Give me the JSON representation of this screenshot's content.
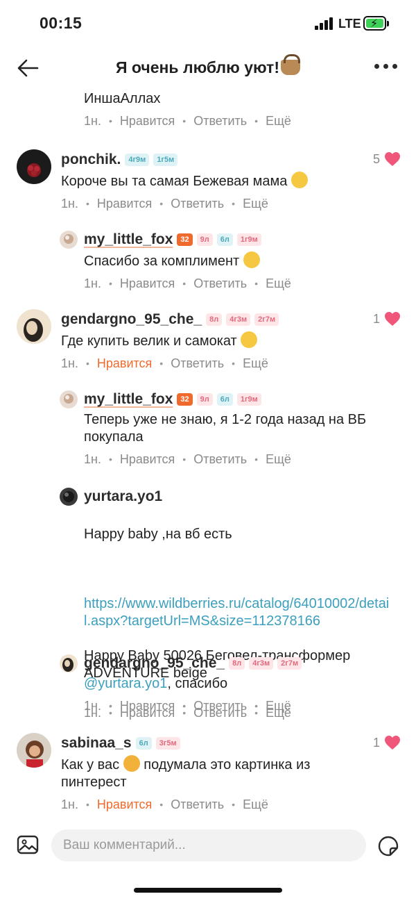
{
  "status_bar": {
    "time": "00:15",
    "network": "LTE"
  },
  "header": {
    "title": "Я очень люблю уют!",
    "title_emoji": "basket-emoji"
  },
  "actions": {
    "like": "Нравится",
    "reply": "Ответить",
    "more": "Ещё"
  },
  "colors": {
    "accent": "#ef6a2c",
    "heart": "#f0557a",
    "link": "#3b9fbd",
    "badge_teal": "#4aa9bb",
    "badge_pink": "#e26a7c"
  },
  "comments": [
    {
      "id": "c0",
      "kind": "reply",
      "text": "ИншаАллах",
      "time": "1н."
    },
    {
      "id": "c1",
      "kind": "top",
      "username": "ponchik.",
      "badges": [
        {
          "text": "4г9м",
          "style": "teal"
        },
        {
          "text": "1г5м",
          "style": "teal"
        }
      ],
      "text": "Короче вы та самая Бежевая мама",
      "time": "1н.",
      "likes": "5"
    },
    {
      "id": "c2",
      "kind": "reply",
      "username": "my_little_fox",
      "badges": [
        {
          "text": "32",
          "style": "orange"
        },
        {
          "text": "9л",
          "style": "pink"
        },
        {
          "text": "6л",
          "style": "teal"
        },
        {
          "text": "1г9м",
          "style": "pink"
        }
      ],
      "text": "Спасибо за комплимент",
      "time": "1н."
    },
    {
      "id": "c3",
      "kind": "top",
      "username": "gendargno_95_che_",
      "badges": [
        {
          "text": "8л",
          "style": "pink"
        },
        {
          "text": "4г3м",
          "style": "pink"
        },
        {
          "text": "2г7м",
          "style": "pink"
        }
      ],
      "text": "Где купить велик и самокат",
      "time": "1н.",
      "likes": "1",
      "liked": true
    },
    {
      "id": "c4",
      "kind": "reply",
      "username": "my_little_fox",
      "badges": [
        {
          "text": "32",
          "style": "orange"
        },
        {
          "text": "9л",
          "style": "pink"
        },
        {
          "text": "6л",
          "style": "teal"
        },
        {
          "text": "1г9м",
          "style": "pink"
        }
      ],
      "text": "Теперь уже не знаю, я 1-2 года назад на ВБ покупала",
      "time": "1н."
    },
    {
      "id": "c5",
      "kind": "reply",
      "username": "yurtara.yo1",
      "badges": [],
      "text_before": "Happy baby ,на вб есть",
      "link": "https://www.wildberries.ru/catalog/64010002/detail.aspx?targetUrl=MS&size=112378166",
      "text_after": "Happy Baby 50026 Беговел-трансформер ADVENTURE beige",
      "time": "1н."
    },
    {
      "id": "c6",
      "kind": "reply",
      "username": "gendargno_95_che_",
      "badges": [
        {
          "text": "8л",
          "style": "pink"
        },
        {
          "text": "4г3м",
          "style": "pink"
        },
        {
          "text": "2г7м",
          "style": "pink"
        }
      ],
      "mention": "@yurtara.yo1",
      "text": ", спасибо",
      "time": "1н."
    },
    {
      "id": "c7",
      "kind": "top",
      "username": "sabinaa_s",
      "badges": [
        {
          "text": "6л",
          "style": "teal"
        },
        {
          "text": "3г5м",
          "style": "pink"
        }
      ],
      "text_before": "Как у вас",
      "text_after": "подумала это картинка из пинтерест",
      "time": "1н.",
      "likes": "1",
      "liked": true
    }
  ],
  "input": {
    "placeholder": "Ваш комментарий..."
  }
}
